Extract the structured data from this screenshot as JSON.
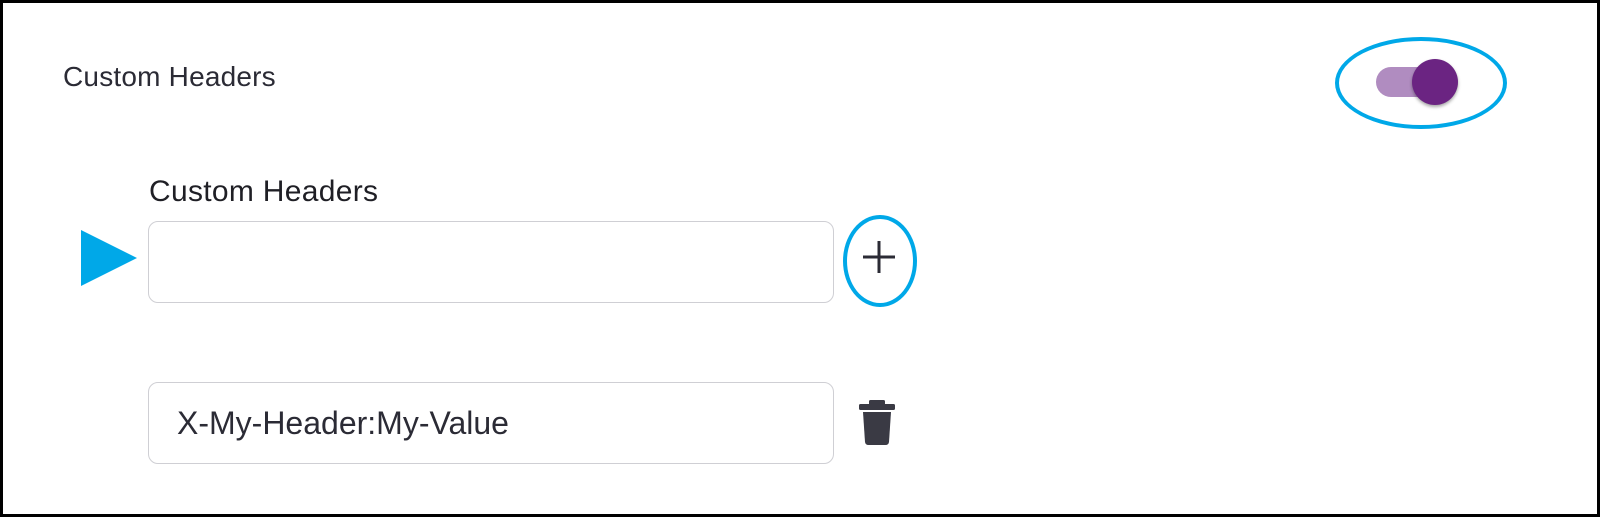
{
  "section": {
    "title": "Custom Headers",
    "toggle": {
      "state": "on",
      "track_color": "#b08cc0",
      "knob_color": "#6b2482"
    }
  },
  "field": {
    "label": "Custom Headers",
    "new_header_value": "",
    "add_icon": "plus-icon"
  },
  "headers": [
    {
      "value": "X-My-Header:My-Value",
      "delete_icon": "trash-icon"
    }
  ],
  "annotations": {
    "callout_color": "#00a8e8",
    "pointer_icon": "triangle-arrow-right-icon"
  }
}
